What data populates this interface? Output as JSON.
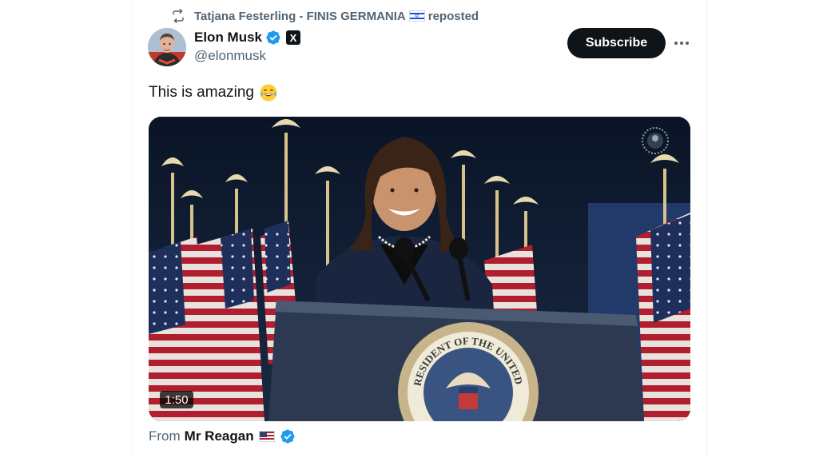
{
  "repost": {
    "user": "Tatjana Festerling - FINIS GERMANIA",
    "suffix": "reposted",
    "flag_icon": "israel-flag-icon"
  },
  "author": {
    "name": "Elon Musk",
    "handle": "@elonmusk",
    "x_badge": "X",
    "verified_color": "#1d9bf0"
  },
  "actions": {
    "subscribe_label": "Subscribe"
  },
  "tweet": {
    "text": "This is amazing",
    "emoji": "face-with-tears-of-joy"
  },
  "media": {
    "duration": "1:50",
    "podium_seal_text": "RESIDENT OF THE UNITED"
  },
  "source": {
    "prefix": "From",
    "name": "Mr Reagan",
    "flag_icon": "us-flag-icon"
  },
  "colors": {
    "text_primary": "#0f1419",
    "text_secondary": "#536471",
    "accent": "#1d9bf0",
    "button_bg": "#0f1419"
  }
}
